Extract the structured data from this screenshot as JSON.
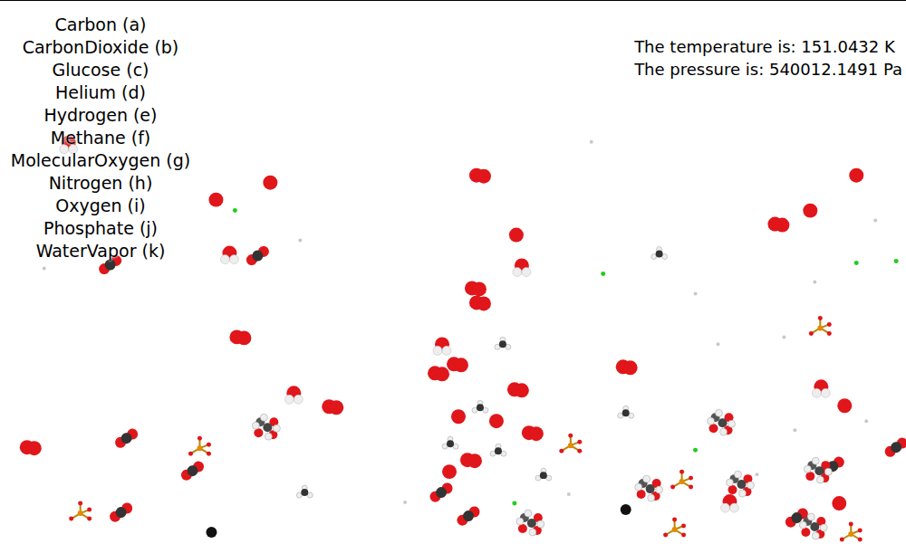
{
  "legend": {
    "items": [
      {
        "label": "Carbon (a)"
      },
      {
        "label": "CarbonDioxide (b)"
      },
      {
        "label": "Glucose (c)"
      },
      {
        "label": "Helium (d)"
      },
      {
        "label": "Hydrogen (e)"
      },
      {
        "label": "Methane (f)"
      },
      {
        "label": "MolecularOxygen (g)"
      },
      {
        "label": "Nitrogen (h)"
      },
      {
        "label": "Oxygen (i)"
      },
      {
        "label": "Phosphate (j)"
      },
      {
        "label": "WaterVapor (k)"
      }
    ]
  },
  "readings": [
    {
      "text": "The temperature is: 151.0432 K"
    },
    {
      "text": "The pressure is: 540012.1491 Pa"
    }
  ]
}
